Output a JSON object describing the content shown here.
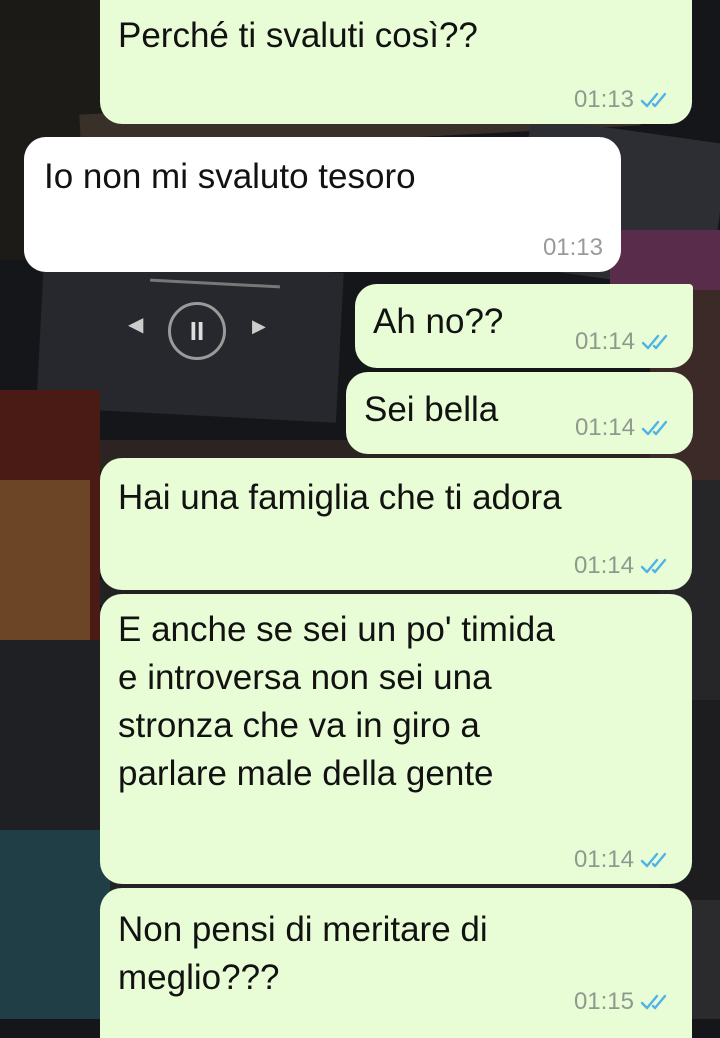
{
  "messages": [
    {
      "id": "m1",
      "direction": "out",
      "text": "Perché ti svaluti così??",
      "time": "01:13",
      "status": "read"
    },
    {
      "id": "m2",
      "direction": "in",
      "text": "Io non mi svaluto tesoro",
      "time": "01:13"
    },
    {
      "id": "m3",
      "direction": "out",
      "text": "Ah no??",
      "time": "01:14",
      "status": "read"
    },
    {
      "id": "m4",
      "direction": "out",
      "text": "Sei bella",
      "time": "01:14",
      "status": "read"
    },
    {
      "id": "m5",
      "direction": "out",
      "text": "Hai una famiglia che ti adora",
      "time": "01:14",
      "status": "read"
    },
    {
      "id": "m6",
      "direction": "out",
      "lines": [
        "E anche se sei un po' timida",
        "e introversa non sei una",
        "stronza che va in giro a",
        "parlare male della gente"
      ],
      "time": "01:14",
      "status": "read"
    },
    {
      "id": "m7",
      "direction": "out",
      "lines": [
        "Non pensi di meritare di",
        "meglio???"
      ],
      "time": "01:15",
      "status": "read"
    }
  ],
  "colors": {
    "outgoing_bubble": "#e8fcd6",
    "incoming_bubble": "#ffffff",
    "read_ticks": "#4fb3e8",
    "timestamp": "#8f9a8f"
  },
  "icons": {
    "read_receipt": "double-check-icon"
  }
}
